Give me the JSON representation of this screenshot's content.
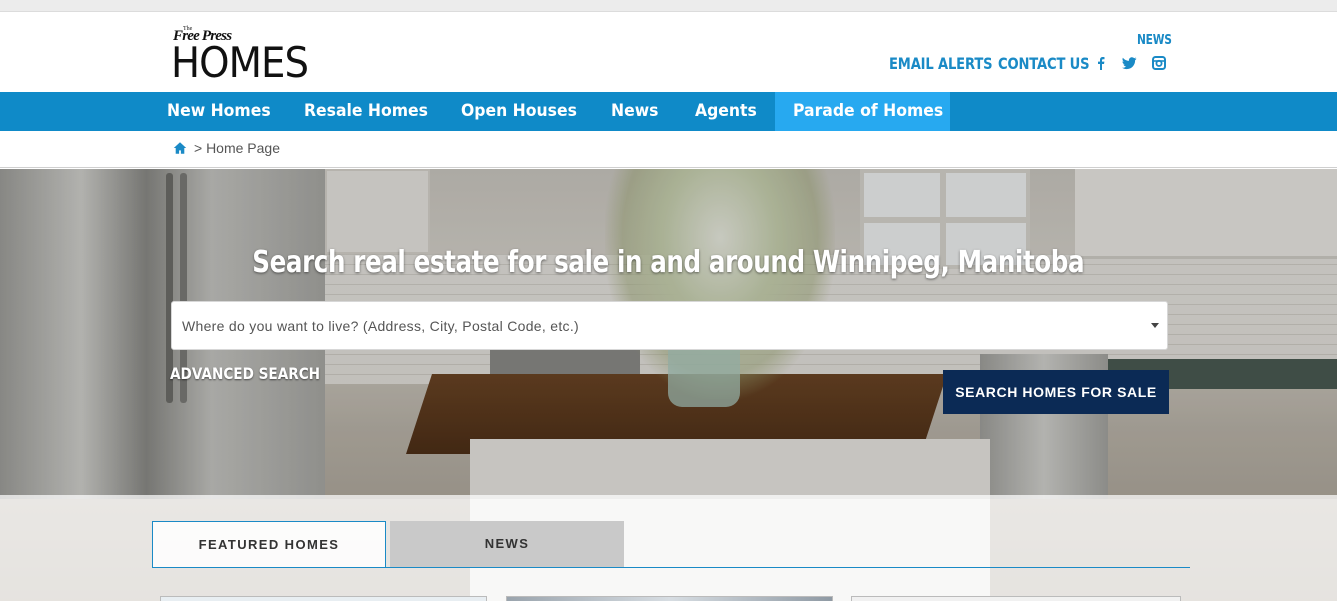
{
  "header": {
    "logo": {
      "small_the": "The",
      "free_press": "Free Press",
      "homes": "HOMES"
    },
    "news_label": "NEWS",
    "email_alerts": "EMAIL ALERTS",
    "contact_us": "CONTACT US",
    "social_icons": [
      "facebook-icon",
      "twitter-icon",
      "instagram-icon"
    ]
  },
  "nav": {
    "items": [
      {
        "label": "New Homes"
      },
      {
        "label": "Resale Homes"
      },
      {
        "label": "Open Houses"
      },
      {
        "label": "News"
      },
      {
        "label": "Agents"
      },
      {
        "label": "Parade of Homes",
        "highlighted": true
      }
    ]
  },
  "breadcrumb": {
    "icon": "home-icon",
    "separator": ">",
    "current": "Home Page",
    "text": "> Home Page"
  },
  "hero": {
    "title": "Search real estate for sale in and around Winnipeg, Manitoba",
    "search_placeholder": "Where do you want to live? (Address, City, Postal Code, etc.)",
    "advanced_search": "ADVANCED SEARCH",
    "search_button": "SEARCH HOMES FOR SALE"
  },
  "tabs": [
    {
      "label": "FEATURED HOMES",
      "active": true
    },
    {
      "label": "NEWS",
      "active": false
    }
  ],
  "colors": {
    "accent": "#1a8ac6",
    "nav_bg": "#0f8ac8",
    "nav_highlight": "#27a9f0",
    "button_bg": "#0b2a55"
  }
}
